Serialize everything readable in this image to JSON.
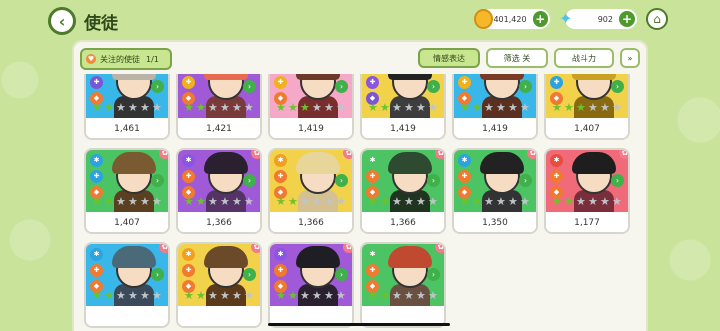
{
  "header": {
    "title": "使徒",
    "gold": "401,420",
    "gems": "902"
  },
  "filters": {
    "favorites_label": "关注的使徒",
    "favorites_count": "1/1",
    "mood_label": "情感表达",
    "filter_label": "筛选 关",
    "power_label": "战斗力"
  },
  "colors": {
    "accent_green": "#4e7a2a",
    "star_on": "#69c42c",
    "star_off": "#bfc4c9"
  },
  "cards": [
    {
      "power": "1,461",
      "bg": "#39b7e8",
      "hair": "#b9b3a8",
      "body": "#333",
      "roles": [
        "#2aa3e0",
        "#7a55d6",
        "#f07a30"
      ],
      "stars": 2,
      "fav": false
    },
    {
      "power": "1,421",
      "bg": "#a05ad8",
      "hair": "#e86a50",
      "body": "#7a3a3a",
      "roles": [
        "#8a55e0",
        "#f0b020",
        "#f07a30"
      ],
      "stars": 2,
      "fav": false
    },
    {
      "power": "1,419",
      "bg": "#f5a8c8",
      "hair": "#6b3a2a",
      "body": "#7a2d2d",
      "roles": [
        "#ea4c3c",
        "#f0b020",
        "#f07a30"
      ],
      "stars": 3,
      "fav": false
    },
    {
      "power": "1,419",
      "bg": "#f2d24a",
      "hair": "#222",
      "body": "#3d3d3d",
      "roles": [
        "#f0a020",
        "#8a55e0",
        "#7a55d6"
      ],
      "stars": 2,
      "fav": false
    },
    {
      "power": "1,419",
      "bg": "#39b7e8",
      "hair": "#7a3a28",
      "body": "#5a3020",
      "roles": [
        "#2aa3e0",
        "#f0b020",
        "#f07a30"
      ],
      "stars": 2,
      "fav": false
    },
    {
      "power": "1,407",
      "bg": "#f2d24a",
      "hair": "#c9a020",
      "body": "#8a6a10",
      "roles": [
        "#f0a020",
        "#2aa3e0",
        "#f07a30"
      ],
      "stars": 3,
      "fav": false
    },
    {
      "power": "1,407",
      "bg": "#4cc463",
      "hair": "#7a5a30",
      "body": "#5a4020",
      "roles": [
        "#2aa3e0",
        "#2aa3e0",
        "#f07a30"
      ],
      "stars": 2,
      "fav": true
    },
    {
      "power": "1,366",
      "bg": "#a05ad8",
      "hair": "#2a2030",
      "body": "#553366",
      "roles": [
        "#8a55e0",
        "#f07a30",
        "#f07a30"
      ],
      "stars": 2,
      "fav": true
    },
    {
      "power": "1,366",
      "bg": "#f2d24a",
      "hair": "#e8d59a",
      "body": "#d4c090",
      "roles": [
        "#f0a020",
        "#f07a30",
        "#f07a30"
      ],
      "stars": 2,
      "fav": true
    },
    {
      "power": "1,366",
      "bg": "#4cc463",
      "hair": "#2e4a30",
      "body": "#203520",
      "roles": [
        "#4cc463",
        "#f07a30",
        "#f07a30"
      ],
      "stars": 2,
      "fav": true
    },
    {
      "power": "1,350",
      "bg": "#4cc463",
      "hair": "#222",
      "body": "#333",
      "roles": [
        "#2aa3e0",
        "#f07a30",
        "#f07a30"
      ],
      "stars": 2,
      "fav": true
    },
    {
      "power": "1,177",
      "bg": "#f06a7a",
      "hair": "#1e1e1e",
      "body": "#7a2d3a",
      "roles": [
        "#ea4c3c",
        "#f07a30",
        "#f07a30"
      ],
      "stars": 2,
      "fav": true
    },
    {
      "power": "",
      "bg": "#39b7e8",
      "hair": "#4a6a7a",
      "body": "#3a4a5a",
      "roles": [
        "#2aa3e0",
        "#f07a30",
        "#f07a30"
      ],
      "stars": 2,
      "fav": true
    },
    {
      "power": "",
      "bg": "#f2d24a",
      "hair": "#6b4a2a",
      "body": "#5a3a1a",
      "roles": [
        "#f0a020",
        "#f07a30",
        "#f07a30"
      ],
      "stars": 2,
      "fav": true
    },
    {
      "power": "",
      "bg": "#a05ad8",
      "hair": "#1e1e24",
      "body": "#2a2030",
      "roles": [
        "#8a55e0",
        "#f07a30",
        "#f07a30"
      ],
      "stars": 2,
      "fav": true
    },
    {
      "power": "",
      "bg": "#4cc463",
      "hair": "#c04a30",
      "body": "#6a5040",
      "roles": [
        "#4cc463",
        "#f07a30",
        "#f07a30"
      ],
      "stars": 2,
      "fav": true
    }
  ]
}
